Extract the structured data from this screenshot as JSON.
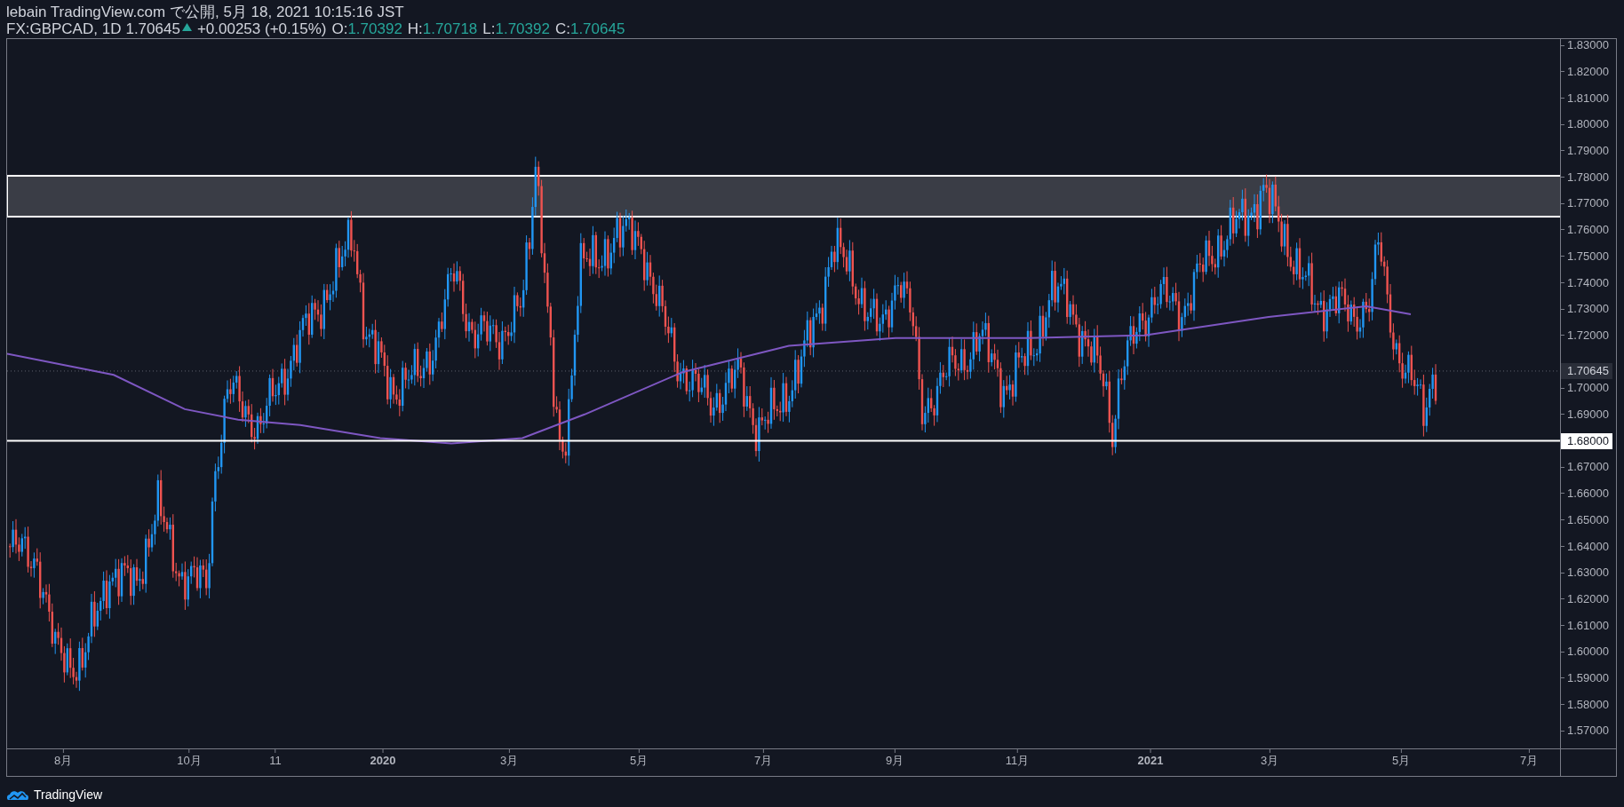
{
  "header": {
    "publisher": "lebain TradingView.com で公開, 5月 18, 2021 10:15:16 JST",
    "symbol": "FX:GBPCAD, 1D",
    "price": "1.70645",
    "change": {
      "kind": "up",
      "text": "+0.00253 (+0.15%)"
    },
    "ohlc": [
      {
        "label": "O:",
        "value": "1.70392"
      },
      {
        "label": "H:",
        "value": "1.70718"
      },
      {
        "label": "L:",
        "value": "1.70392"
      },
      {
        "label": "C:",
        "value": "1.70645"
      }
    ]
  },
  "y_axis": {
    "ticks_upper": [
      "1.83000",
      "1.82000",
      "1.81000",
      "1.80000",
      "1.79000",
      "1.78000",
      "1.77000",
      "1.76000",
      "1.75000",
      "1.74000",
      "1.73000",
      "1.72000"
    ],
    "ticks_middle": [
      "1.70000",
      "1.69000"
    ],
    "ticks_lower": [
      "1.67000",
      "1.66000",
      "1.65000",
      "1.64000",
      "1.63000",
      "1.62000",
      "1.61000",
      "1.60000",
      "1.59000",
      "1.58000",
      "1.57000"
    ],
    "price_label": "1.70645",
    "line_label": "1.68000"
  },
  "x_axis": {
    "ticks": [
      {
        "label": "8月",
        "kind": "month"
      },
      {
        "label": "10月",
        "kind": "month"
      },
      {
        "label": "11",
        "kind": "month"
      },
      {
        "label": "2020",
        "kind": "year"
      },
      {
        "label": "3月",
        "kind": "month"
      },
      {
        "label": "5月",
        "kind": "month"
      },
      {
        "label": "7月",
        "kind": "month"
      },
      {
        "label": "9月",
        "kind": "month"
      },
      {
        "label": "11月",
        "kind": "month"
      },
      {
        "label": "2021",
        "kind": "year"
      },
      {
        "label": "3月",
        "kind": "month"
      },
      {
        "label": "5月",
        "kind": "month"
      },
      {
        "label": "7月",
        "kind": "month"
      }
    ]
  },
  "footer": {
    "brand": "TradingView"
  }
}
